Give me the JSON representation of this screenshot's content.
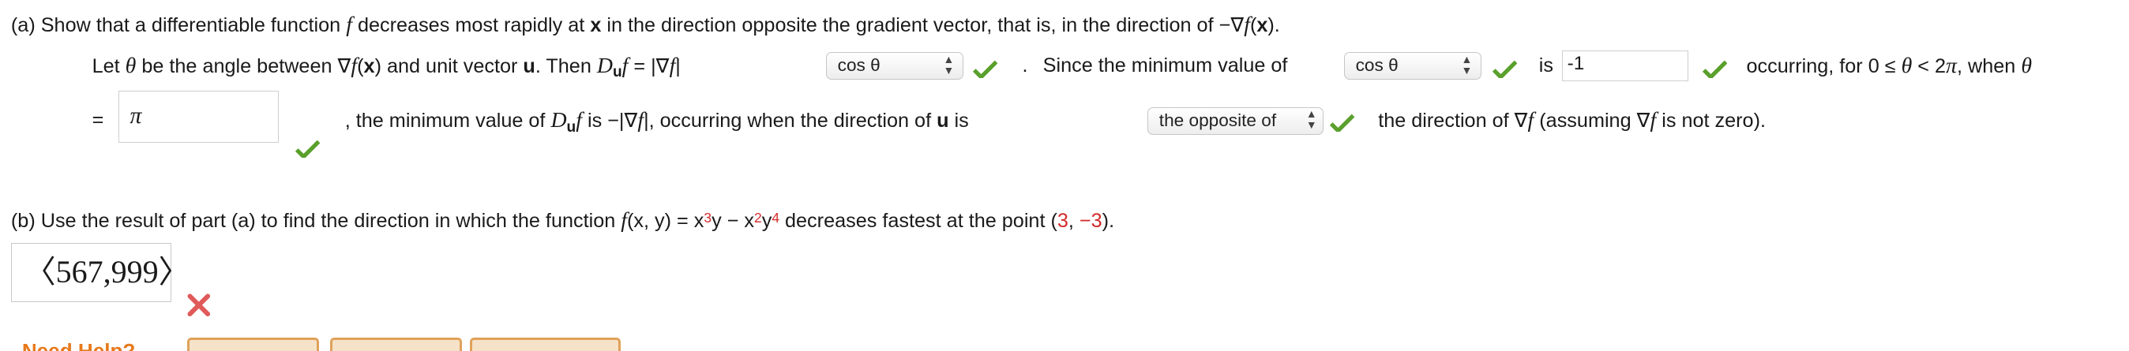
{
  "part_a": {
    "line1": "(a) Show that a differentiable function ",
    "f": "f",
    "line1b": " decreases most rapidly at ",
    "x": "x",
    "line1c": " in the direction opposite the gradient vector, that is, in the direction of −∇",
    "line1d": "(",
    "line1e": ").",
    "let_text": "Let ",
    "theta": "θ",
    "let_b": " be the angle between ∇",
    "let_c": "(",
    "let_d": ") and unit vector ",
    "u": "u",
    "then": ". Then ",
    "D": "D",
    "eq_grad": " = |∇",
    "bar": "|",
    "select1": "cos θ",
    "dot": ".",
    "since": "Since the minimum value of",
    "select2": "cos θ",
    "is": "is",
    "input1": "-1",
    "occurring": "occurring, for  0 ≤ ",
    "range_mid": " < 2",
    "pi": "π",
    "when": ",  when ",
    "eq": "=",
    "input2": "π",
    "comma_min": ", the minimum value of ",
    "is2": " is  −|∇",
    "occ2": "|,  occurring when the direction of ",
    "is3": " is",
    "select3": "the opposite of",
    "dir_of": "the direction of  ∇",
    "assuming": "  (assuming  ∇",
    "not_zero": "  is not zero)."
  },
  "part_b": {
    "text1": "(b) Use the result of part (a) to find the direction in which the function  ",
    "func": "f",
    "func_args": "(x, y) = x",
    "exp3": "3",
    "mid": "y − x",
    "exp2": "2",
    "y": "y",
    "exp4": "4",
    "text2": "  decreases fastest at the point  (",
    "pt1": "3",
    "sep": ", ",
    "pt2": "−3",
    "close": ").",
    "answer": "〈567,999〉"
  },
  "need_help": "Need Help?",
  "colors": {
    "check": "#5aa02c",
    "wrong": "#e05a5a",
    "point": "#d42b2b",
    "help": "#e8791b"
  }
}
